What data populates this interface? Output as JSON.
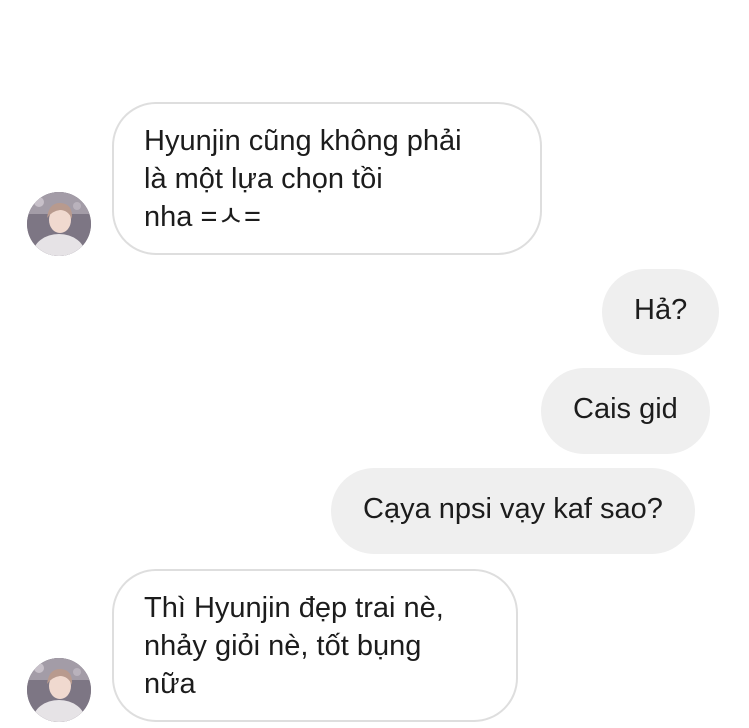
{
  "chat": {
    "messages": [
      {
        "direction": "incoming",
        "text": "Hyunjin cũng không phải\nlà một lựa chọn tồi\nnha =ㅅ="
      },
      {
        "direction": "outgoing",
        "text": "Hả?"
      },
      {
        "direction": "outgoing",
        "text": "Cais gid"
      },
      {
        "direction": "outgoing",
        "text": "Cạya npsi vạy kaf sao?"
      },
      {
        "direction": "incoming",
        "text": "Thì Hyunjin đẹp trai nè,\nnhảy giỏi nè, tốt bụng\nnữa"
      }
    ]
  },
  "colors": {
    "background": "#ffffff",
    "incoming_border": "#dedede",
    "outgoing_fill": "#efefef",
    "text": "#1c1c1c"
  },
  "icons": {
    "avatar": "profile-photo-avatar"
  }
}
